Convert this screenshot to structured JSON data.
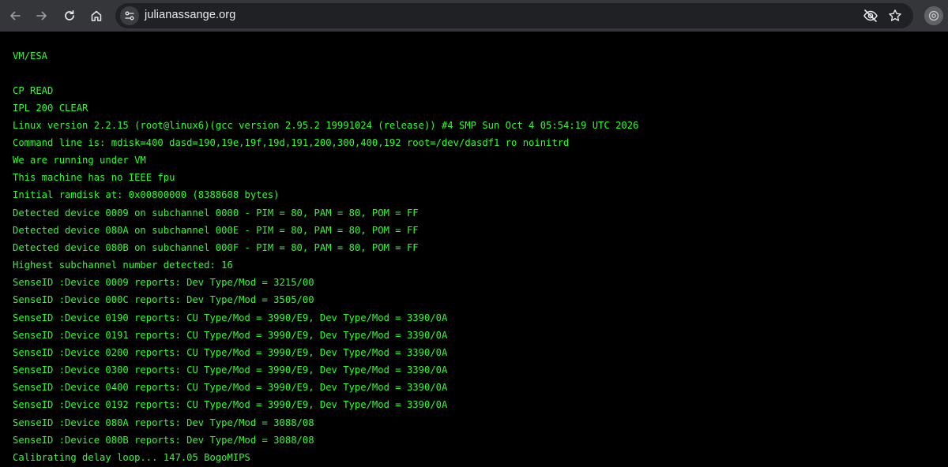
{
  "browser": {
    "url": "julianassange.org",
    "icons": {
      "back": "arrow-left-icon",
      "forward": "arrow-right-icon",
      "reload": "reload-icon",
      "home": "home-icon",
      "site_info": "tune-icon",
      "tracking": "eye-off-icon",
      "bookmark": "star-icon",
      "profile": "profile-icon"
    }
  },
  "terminal": {
    "text_color": "#2bff2b",
    "background": "#000000",
    "lines": [
      "VM/ESA",
      "",
      "CP READ",
      "IPL 200 CLEAR",
      "Linux version 2.2.15 (root@linux6)(gcc version 2.95.2 19991024 (release)) #4 SMP Sun Oct 4 05:54:19 UTC 2026",
      "Command line is: mdisk=400 dasd=190,19e,19f,19d,191,200,300,400,192 root=/dev/dasdf1 ro noinitrd",
      "We are running under VM",
      "This machine has no IEEE fpu",
      "Initial ramdisk at: 0x00800000 (8388608 bytes)",
      "Detected device 0009 on subchannel 0000 - PIM = 80, PAM = 80, POM = FF",
      "Detected device 080A on subchannel 000E - PIM = 80, PAM = 80, POM = FF",
      "Detected device 080B on subchannel 000F - PIM = 80, PAM = 80, POM = FF",
      "Highest subchannel number detected: 16",
      "SenseID :Device 0009 reports: Dev Type/Mod = 3215/00",
      "SenseID :Device 000C reports: Dev Type/Mod = 3505/00",
      "SenseID :Device 0190 reports: CU Type/Mod = 3990/E9, Dev Type/Mod = 3390/0A",
      "SenseID :Device 0191 reports: CU Type/Mod = 3990/E9, Dev Type/Mod = 3390/0A",
      "SenseID :Device 0200 reports: CU Type/Mod = 3990/E9, Dev Type/Mod = 3390/0A",
      "SenseID :Device 0300 reports: CU Type/Mod = 3990/E9, Dev Type/Mod = 3390/0A",
      "SenseID :Device 0400 reports: CU Type/Mod = 3990/E9, Dev Type/Mod = 3390/0A",
      "SenseID :Device 0192 reports: CU Type/Mod = 3990/E9, Dev Type/Mod = 3390/0A",
      "SenseID :Device 080A reports: Dev Type/Mod = 3088/08",
      "SenseID :Device 080B reports: Dev Type/Mod = 3088/08",
      "Calibrating delay loop... 147.05 BogoMIPS"
    ]
  }
}
